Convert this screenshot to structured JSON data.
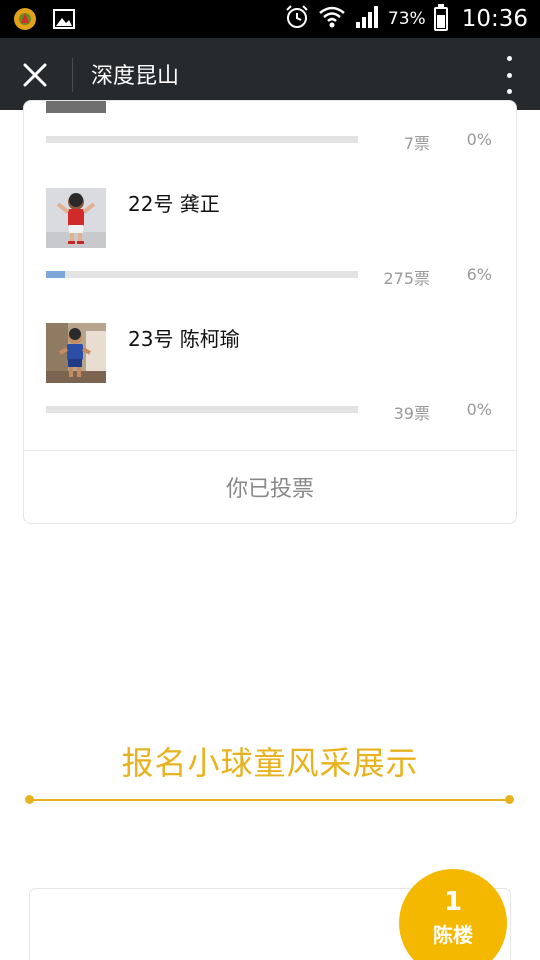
{
  "status_bar": {
    "battery_text": "73%",
    "time": "10:36",
    "battery_level": 0.73,
    "icons": [
      "notification-app-icon",
      "image-icon",
      "alarm-icon",
      "wifi-icon",
      "signal-icon",
      "battery-icon"
    ]
  },
  "app_bar": {
    "title": "深度昆山",
    "close_icon": "close-icon",
    "more_icon": "more-vertical-icon"
  },
  "vote": {
    "items": [
      {
        "name": "",
        "votes": "7票",
        "percent": "0%",
        "fraction": 0.0
      },
      {
        "name": "22号 龚正",
        "votes": "275票",
        "percent": "6%",
        "fraction": 0.06
      },
      {
        "name": "23号 陈柯瑜",
        "votes": "39票",
        "percent": "0%",
        "fraction": 0.0
      }
    ],
    "voted_label": "你已投票"
  },
  "section": {
    "title": "报名小球童风采展示"
  },
  "rank": {
    "number": "1",
    "name": "陈楼"
  },
  "colors": {
    "accent": "#e8b21e",
    "badge": "#f5b800",
    "bar_fill": "#7aa7d8",
    "app_bar": "#272a2c"
  }
}
